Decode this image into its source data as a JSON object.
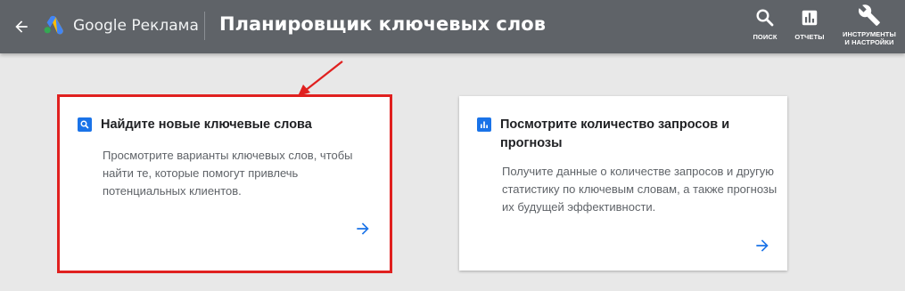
{
  "header": {
    "brand": "Google Реклама",
    "page_title": "Планировщик ключевых слов",
    "tools": [
      {
        "label": "ПОИСК",
        "icon": "search-icon"
      },
      {
        "label": "ОТЧЕТЫ",
        "icon": "reports-icon"
      },
      {
        "label": "ИНСТРУМЕНТЫ\nИ НАСТРОЙКИ",
        "label_line1": "ИНСТРУМЕНТЫ",
        "label_line2": "И НАСТРОЙКИ",
        "icon": "wrench-icon"
      }
    ]
  },
  "cards": [
    {
      "title": "Найдите новые ключевые слова",
      "description": "Просмотрите варианты ключевых слов, чтобы найти те, которые помогут привлечь потенциальных клиентов.",
      "icon": "search-icon",
      "highlighted": true
    },
    {
      "title": "Посмотрите количество запросов и прогнозы",
      "description": "Получите данные о количестве запросов и другую статистику по ключевым словам, а также прогнозы их будущей эффективности.",
      "icon": "chart-icon",
      "highlighted": false
    }
  ],
  "colors": {
    "header_bg": "#5f6368",
    "accent": "#1a73e8",
    "highlight": "#e0201f",
    "page_bg": "#e8e8e8"
  }
}
